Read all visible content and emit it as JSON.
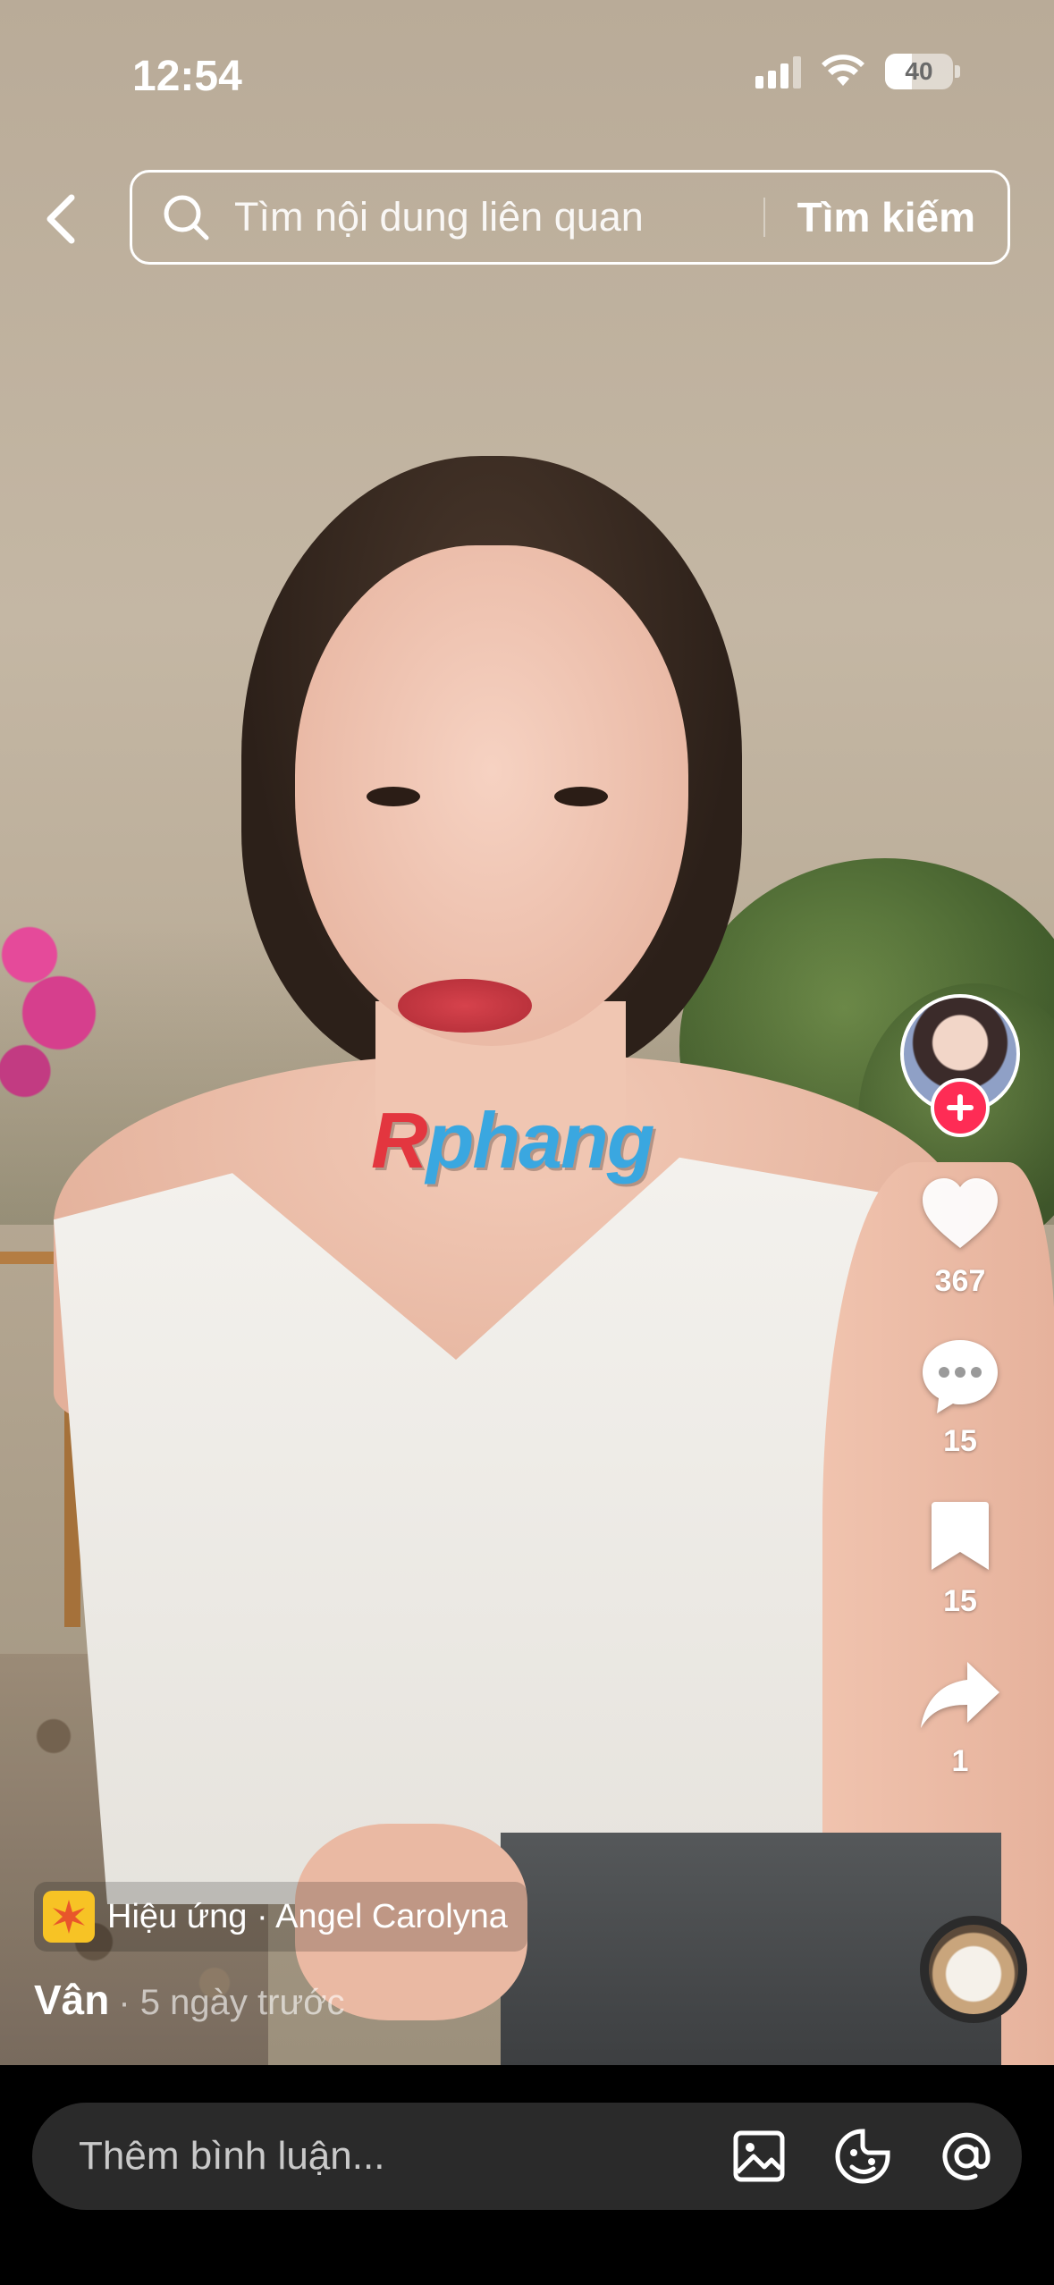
{
  "status_bar": {
    "time": "12:54",
    "battery": "40",
    "battery_level": 0.4
  },
  "header": {
    "back_icon": "chevron-left-icon",
    "search_placeholder": "Tìm nội dung liên quan",
    "search_button": "Tìm kiếm"
  },
  "watermark": {
    "prefix": "R",
    "rest": "phang"
  },
  "rail": {
    "follow_icon": "plus-icon",
    "likes": "367",
    "comments": "15",
    "saves": "15",
    "shares": "1"
  },
  "caption": {
    "effect_label": "Hiệu ứng · Angel Carolyna",
    "author": "Vân",
    "posted": "· 5 ngày trước"
  },
  "comment_bar": {
    "placeholder": "Thêm bình luận...",
    "icons": [
      "image-icon",
      "emoji-icon",
      "mention-icon"
    ]
  },
  "colors": {
    "accent": "#fe2c55",
    "effect_badge": "#f7c325"
  }
}
